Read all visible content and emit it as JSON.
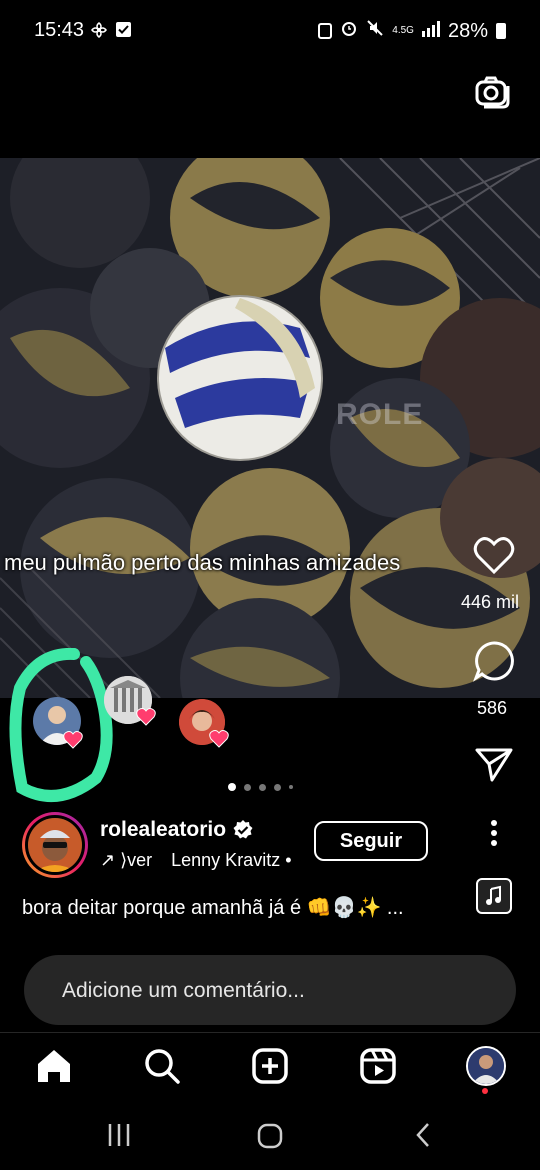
{
  "status_bar": {
    "time": "15:43",
    "network": "4.5G",
    "battery": "28%"
  },
  "post": {
    "image_caption": "meu pulmão perto das minhas amizades",
    "watermark": "ROLE",
    "likes": "446 mil",
    "comments": "586",
    "username": "rolealeatorio",
    "audio_prefix": "↗ ⟩ver",
    "audio_artist": "Lenny Kravitz •",
    "follow_label": "Seguir",
    "caption": "bora deitar porque amanhã já é 👊💀✨ ...",
    "carousel_count": 5,
    "carousel_active": 0
  },
  "comment": {
    "placeholder": "Adicione um comentário..."
  },
  "colors": {
    "accent_green": "#3ee8a6",
    "heart_pink": "#ff3d6e",
    "input_bg": "#262626"
  },
  "icons": [
    "camera-icon",
    "heart-icon",
    "comment-icon",
    "share-icon",
    "more-icon",
    "music-icon",
    "home-icon",
    "search-icon",
    "add-icon",
    "reels-icon",
    "profile-icon"
  ]
}
